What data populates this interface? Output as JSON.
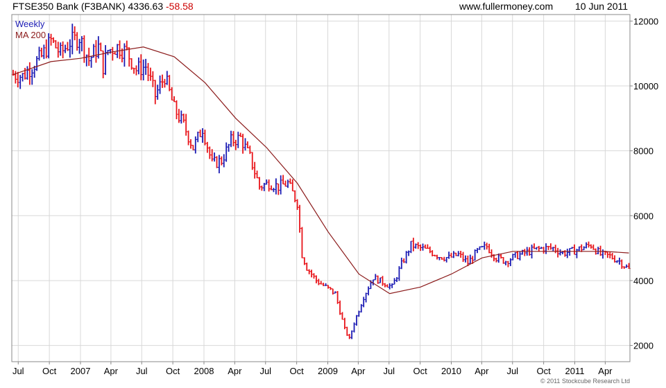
{
  "header": {
    "title": "FTSE350 Bank (F3BANK)",
    "last": "4336.63",
    "change": "-58.58",
    "site": "www.fullermoney.com",
    "date": "10 Jun 2011"
  },
  "legend": {
    "series1": "Weekly",
    "series2": "MA 200"
  },
  "copyright": "© 2011 Stockcube Research Ltd",
  "colors": {
    "up": "#1c1cb4",
    "down": "#e8141a",
    "ma": "#8b1a1a",
    "grid": "#d8d8d8",
    "frame": "#888888"
  },
  "chart_data": {
    "type": "line",
    "subtype": "weekly-ohlc-bars-with-moving-average",
    "ylim": [
      1500,
      12200
    ],
    "yticks": [
      2000,
      4000,
      6000,
      8000,
      10000,
      12000
    ],
    "ytick_labels": [
      "2000",
      "4000",
      "6000",
      "8000",
      "10000",
      "12000"
    ],
    "xlim": [
      "2006-06-12",
      "2011-06-13"
    ],
    "xticks": [
      {
        "date": "2006-07-01",
        "label": "Jul"
      },
      {
        "date": "2006-10-01",
        "label": "Oct"
      },
      {
        "date": "2007-01-01",
        "label": "2007"
      },
      {
        "date": "2007-04-01",
        "label": "Apr"
      },
      {
        "date": "2007-07-01",
        "label": "Jul"
      },
      {
        "date": "2007-10-01",
        "label": "Oct"
      },
      {
        "date": "2008-01-01",
        "label": "2008"
      },
      {
        "date": "2008-04-01",
        "label": "Apr"
      },
      {
        "date": "2008-07-01",
        "label": "Jul"
      },
      {
        "date": "2008-10-01",
        "label": "Oct"
      },
      {
        "date": "2009-01-01",
        "label": "2009"
      },
      {
        "date": "2009-04-01",
        "label": "Apr"
      },
      {
        "date": "2009-07-01",
        "label": "Jul"
      },
      {
        "date": "2009-10-01",
        "label": "Oct"
      },
      {
        "date": "2010-01-01",
        "label": "2010"
      },
      {
        "date": "2010-04-01",
        "label": "Apr"
      },
      {
        "date": "2010-07-01",
        "label": "Jul"
      },
      {
        "date": "2010-10-01",
        "label": "Oct"
      },
      {
        "date": "2011-01-01",
        "label": "2011"
      },
      {
        "date": "2011-04-01",
        "label": "Apr"
      }
    ],
    "grid": true,
    "series": [
      {
        "name": "Weekly",
        "kind": "close",
        "dates": [
          "2006-06-16",
          "2006-07-14",
          "2006-08-11",
          "2006-09-08",
          "2006-10-06",
          "2006-11-03",
          "2006-12-01",
          "2006-12-29",
          "2007-01-26",
          "2007-02-23",
          "2007-03-09",
          "2007-03-23",
          "2007-04-20",
          "2007-05-18",
          "2007-06-15",
          "2007-07-13",
          "2007-08-10",
          "2007-09-07",
          "2007-10-05",
          "2007-11-02",
          "2007-11-30",
          "2007-12-28",
          "2008-01-25",
          "2008-02-22",
          "2008-03-21",
          "2008-04-18",
          "2008-05-16",
          "2008-06-13",
          "2008-07-11",
          "2008-08-08",
          "2008-09-05",
          "2008-10-03",
          "2008-10-17",
          "2008-10-31",
          "2008-11-28",
          "2008-12-26",
          "2009-01-23",
          "2009-02-20",
          "2009-03-06",
          "2009-03-20",
          "2009-04-17",
          "2009-05-15",
          "2009-06-12",
          "2009-07-10",
          "2009-08-07",
          "2009-09-04",
          "2009-10-02",
          "2009-10-30",
          "2009-11-27",
          "2009-12-25",
          "2010-01-22",
          "2010-02-19",
          "2010-03-19",
          "2010-04-16",
          "2010-05-14",
          "2010-06-11",
          "2010-07-09",
          "2010-08-06",
          "2010-09-03",
          "2010-10-01",
          "2010-10-29",
          "2010-11-26",
          "2010-12-24",
          "2011-01-21",
          "2011-02-18",
          "2011-03-18",
          "2011-04-15",
          "2011-05-13",
          "2011-06-10"
        ],
        "values": [
          10350,
          10300,
          10600,
          10900,
          11400,
          11000,
          11350,
          11500,
          10800,
          11200,
          10600,
          11100,
          11200,
          11050,
          10500,
          10600,
          9700,
          10300,
          9300,
          8800,
          8100,
          8700,
          7600,
          7700,
          8300,
          8400,
          7800,
          6900,
          7000,
          6900,
          7000,
          6400,
          4800,
          4400,
          4000,
          3800,
          3600,
          2500,
          2200,
          2700,
          3500,
          4100,
          3950,
          3800,
          4500,
          5100,
          5000,
          4900,
          4750,
          4700,
          4800,
          4550,
          4900,
          5050,
          4700,
          4600,
          4750,
          4850,
          4950,
          5000,
          5000,
          4850,
          4900,
          5000,
          5100,
          4800,
          4750,
          4600,
          4340
        ]
      },
      {
        "name": "MA 200",
        "kind": "moving-average",
        "dates": [
          "2006-06-16",
          "2006-10-06",
          "2007-01-01",
          "2007-04-06",
          "2007-07-06",
          "2007-10-05",
          "2008-01-04",
          "2008-04-04",
          "2008-07-04",
          "2008-10-03",
          "2009-01-02",
          "2009-04-03",
          "2009-07-03",
          "2009-10-02",
          "2010-01-01",
          "2010-04-02",
          "2010-07-02",
          "2010-10-01",
          "2011-01-07",
          "2011-04-01",
          "2011-06-10"
        ],
        "values": [
          10350,
          10750,
          10850,
          11050,
          11200,
          10900,
          10100,
          9000,
          8100,
          7000,
          5500,
          4200,
          3600,
          3800,
          4200,
          4700,
          4900,
          4900,
          4900,
          4900,
          4850
        ]
      }
    ]
  }
}
